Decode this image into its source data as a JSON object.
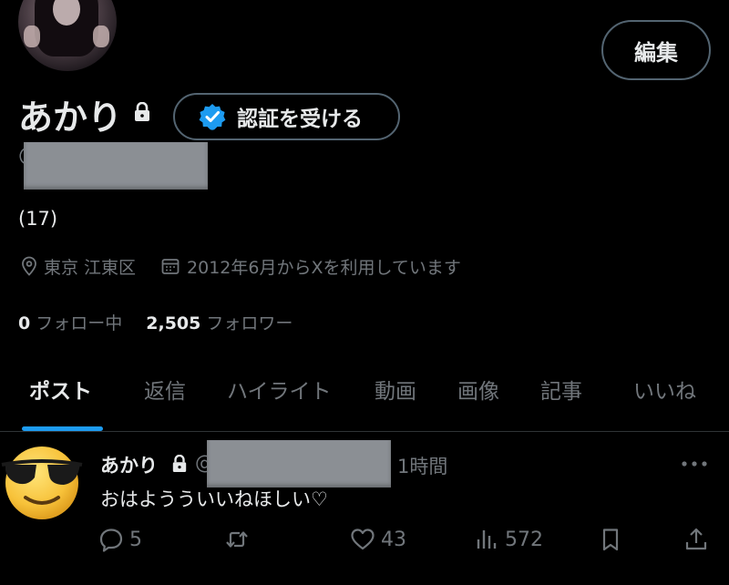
{
  "profile": {
    "display_name": "あかり",
    "edit_label": "編集",
    "verify_label": "認証を受ける",
    "handle_prefix": "@",
    "bio": "(17)",
    "location": "東京 江東区",
    "joined": "2012年6月からXを利用しています",
    "following_count": "0",
    "following_label": "フォロー中",
    "followers_count": "2,505",
    "followers_label": "フォロワー"
  },
  "tabs": [
    {
      "label": "ポスト",
      "active": true
    },
    {
      "label": "返信"
    },
    {
      "label": "ハイライト"
    },
    {
      "label": "動画"
    },
    {
      "label": "画像"
    },
    {
      "label": "記事"
    },
    {
      "label": "いいね"
    }
  ],
  "post": {
    "author": "あかり",
    "handle_prefix": "@",
    "time": "1時間",
    "text": "おはようういいねほしい♡",
    "replies": "5",
    "likes": "43",
    "views": "572"
  },
  "icons": {
    "avatar": "profile-photo",
    "verify": "verified-badge-icon",
    "lock": "lock-icon",
    "location": "location-pin-icon",
    "calendar": "calendar-icon",
    "post_avatar": "sunglasses-emoji",
    "reply": "reply-icon",
    "repost": "repost-icon",
    "like": "heart-icon",
    "views": "views-icon",
    "bookmark": "bookmark-icon",
    "share": "share-icon",
    "more": "more-icon"
  },
  "colors": {
    "background": "#000000",
    "text": "#e7e9ea",
    "muted": "#71767b",
    "accent": "#1d9bf0",
    "border": "#536471"
  }
}
